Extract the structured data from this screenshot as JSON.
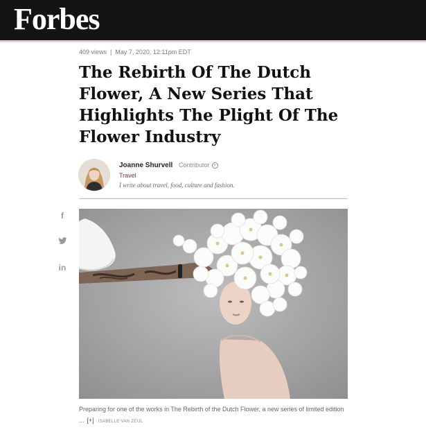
{
  "brand": {
    "logo": "Forbes"
  },
  "article": {
    "views": "409 views",
    "separator": "|",
    "date": "May 7, 2020, 12:11pm EDT",
    "headline": "The Rebirth Of The Dutch Flower, A New Series That Highlights The Plight Of The Flower Industry"
  },
  "author": {
    "name": "Joanne Shurvell",
    "role": "Contributor",
    "role_icon": "plus-circle-icon",
    "section": "Travel",
    "bio": "I write about travel, food, culture and fashion."
  },
  "share": {
    "facebook": "f",
    "twitter_icon": "twitter-bird-icon",
    "linkedin": "in"
  },
  "image": {
    "caption": "Preparing for one of the works in The Rebirth of the Dutch Flower, a new series of limited edition ...",
    "expand": "[+]",
    "credit": "ISABELLE VAN ZEIJL"
  },
  "colors": {
    "topbar": "#141414",
    "accent": "#e8c9d6",
    "section_link": "#7a3556"
  }
}
